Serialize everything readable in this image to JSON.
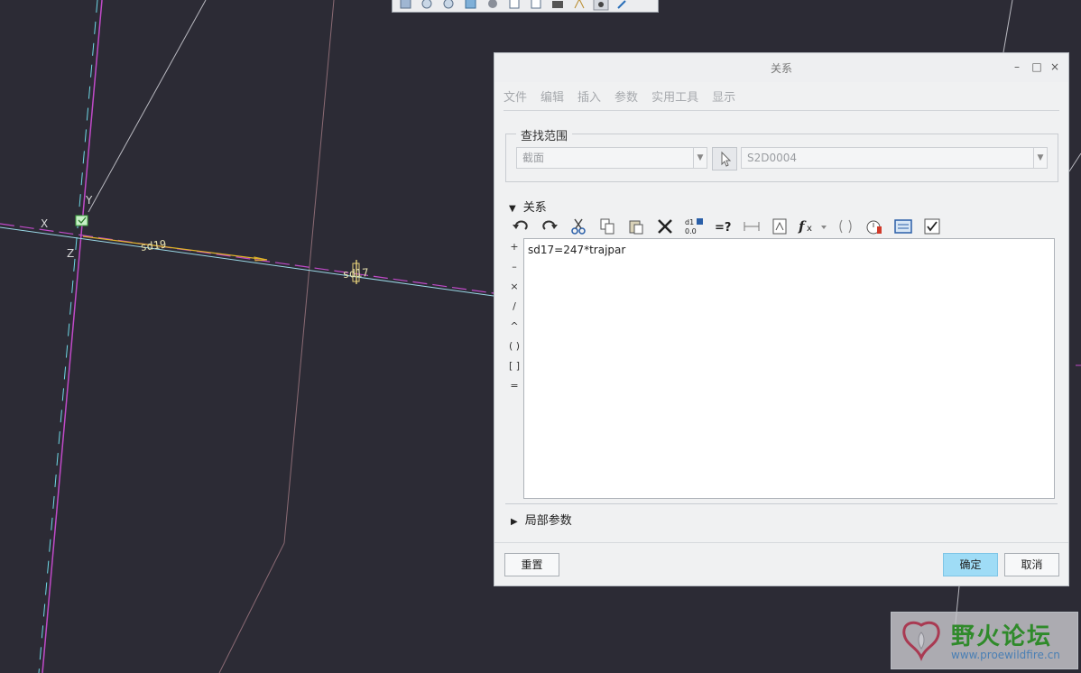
{
  "viewport": {
    "axis_labels": {
      "x": "X",
      "y": "Y",
      "z": "Z"
    },
    "dimension_labels": [
      "sd19",
      "sd17"
    ],
    "colors": {
      "background": "#2c2b35",
      "magenta_line": "#c04ac8",
      "cyan_line": "#6ed8e6",
      "yellow_line": "#e0b32a",
      "sketch_text": "#e8e2b0"
    }
  },
  "view_toolbar": {
    "icons": [
      "zoom-refit-icon",
      "zoom-in-icon",
      "zoom-out-icon",
      "repaint-icon",
      "display-style-icon",
      "saved-views-icon",
      "view-manager-icon",
      "camera-icon",
      "spin-center-icon",
      "datum-display-icon",
      "annotation-display-icon"
    ]
  },
  "dialog": {
    "title": "关系",
    "window_buttons": {
      "minimize": "–",
      "maximize": "□",
      "close": "×"
    },
    "menu": [
      "文件",
      "编辑",
      "插入",
      "参数",
      "实用工具",
      "显示"
    ],
    "find_scope": {
      "label": "查找范围",
      "scope_value": "截面",
      "item_value": "S2D0004"
    },
    "relations": {
      "label": "关系",
      "toolbar_icons": [
        "undo-icon",
        "redo-icon",
        "cut-icon",
        "copy-icon",
        "paste-icon",
        "delete-icon",
        "switch-dimensions-icon",
        "evaluate-icon",
        "insert-dimension-icon",
        "insert-parameter-icon",
        "insert-function-icon",
        "insert-parentheses-icon",
        "verify-icon",
        "sort-icon",
        "show-value-icon"
      ],
      "operators": [
        "+",
        "–",
        "×",
        "/",
        "^",
        "( )",
        "[ ]",
        "="
      ],
      "text": "sd17=247*trajpar"
    },
    "local_params": {
      "label": "局部参数"
    },
    "buttons": {
      "reset": "重置",
      "ok": "确定",
      "cancel": "取消"
    }
  },
  "watermark": {
    "title": "野火论坛",
    "url": "www.proewildfire.cn"
  }
}
